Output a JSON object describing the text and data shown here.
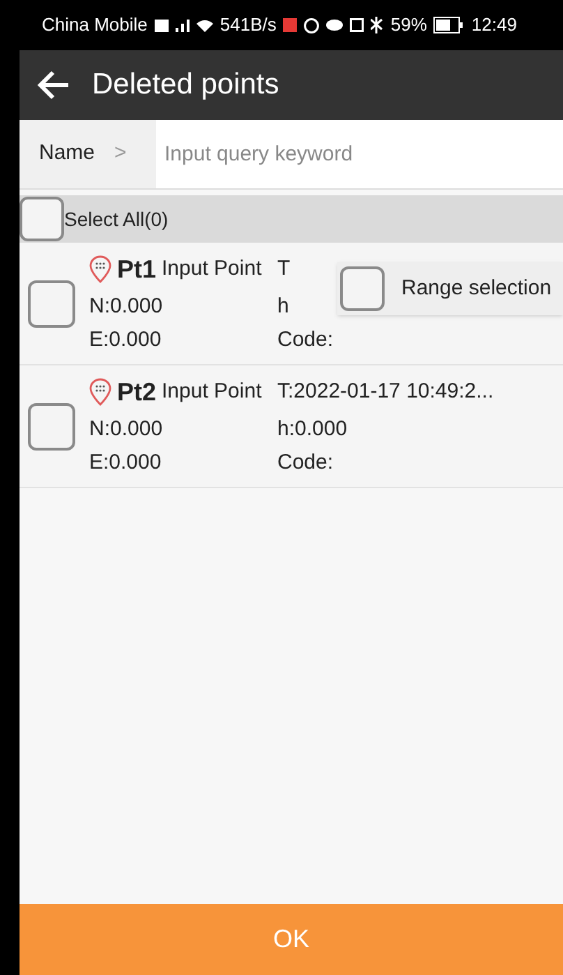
{
  "status_bar": {
    "carrier": "China Mobile",
    "speed": "541B/s",
    "battery": "59%",
    "time": "12:49"
  },
  "title_bar": {
    "title": "Deleted points"
  },
  "search": {
    "field": "Name",
    "separator": ">",
    "placeholder": "Input query keyword"
  },
  "select_all": {
    "label": "Select All(0)",
    "checked": false
  },
  "points": [
    {
      "name": "Pt1",
      "type": "Input Point",
      "time": "T",
      "n": "N:0.000",
      "h": "h",
      "e": "E:0.000",
      "code": "Code:",
      "checked": false
    },
    {
      "name": "Pt2",
      "type": "Input Point",
      "time": "T:2022-01-17 10:49:2...",
      "n": "N:0.000",
      "h": "h:0.000",
      "e": "E:0.000",
      "code": "Code:",
      "checked": false
    }
  ],
  "range_selection": {
    "label": "Range selection",
    "checked": false
  },
  "ok_button": "OK"
}
